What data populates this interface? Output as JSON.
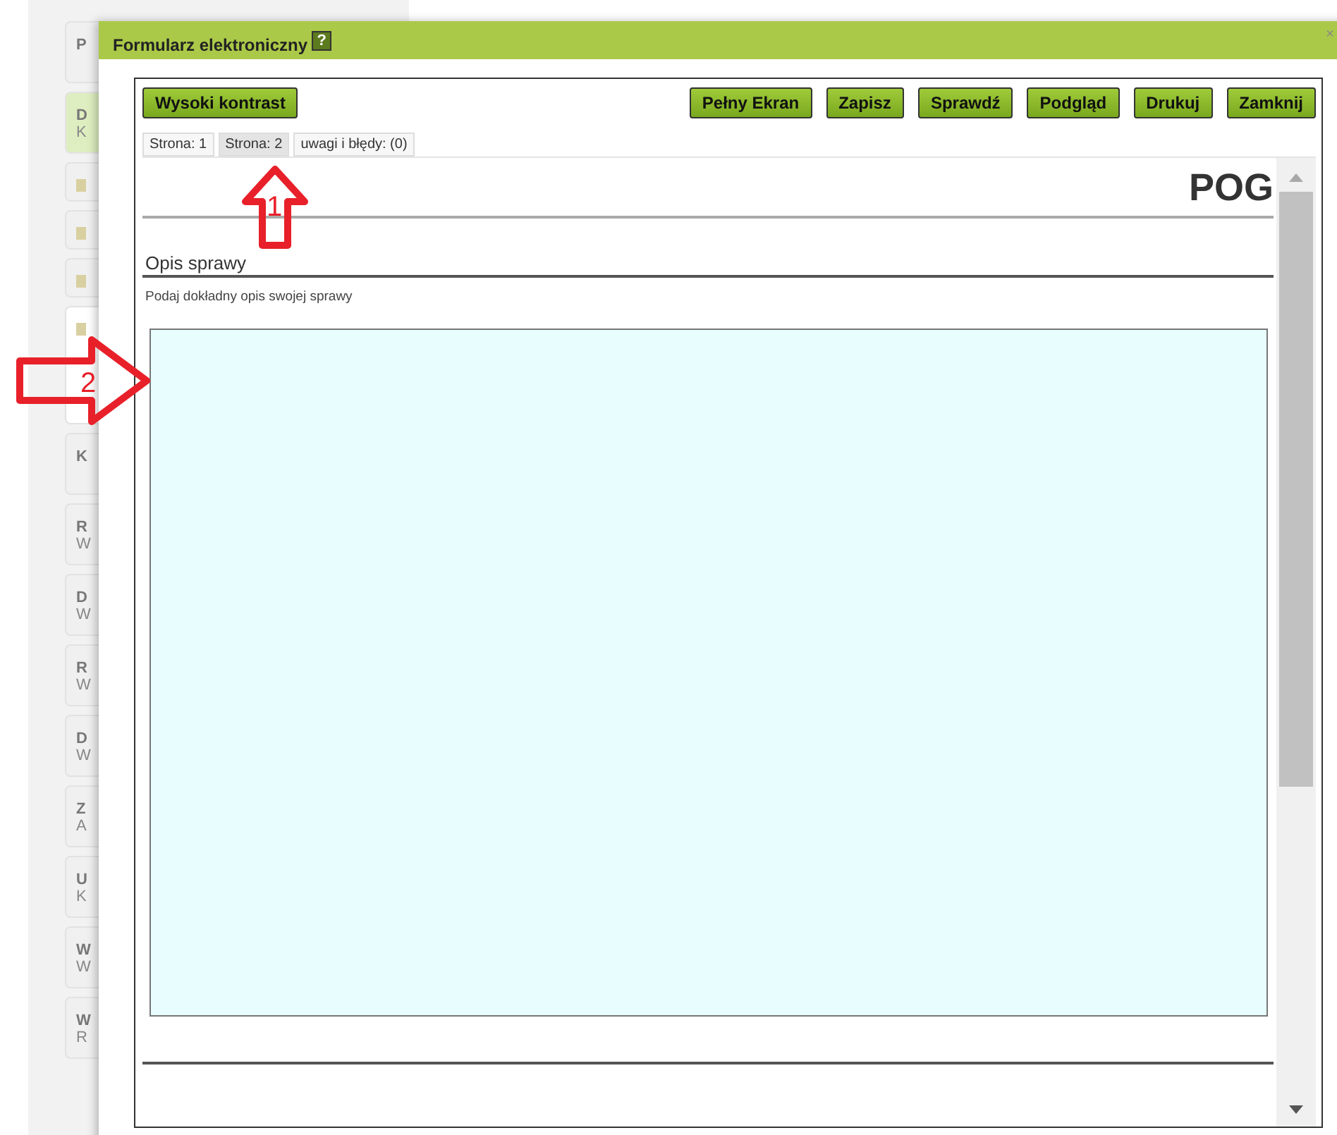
{
  "background_list": [
    {
      "title": "P",
      "kind": "text",
      "selected": false
    },
    {
      "title": "D",
      "subtitle": "K",
      "kind": "text",
      "selected": true
    },
    {
      "kind": "icon",
      "selected": false
    },
    {
      "kind": "icon",
      "selected": false
    },
    {
      "kind": "icon",
      "selected": false
    },
    {
      "kind": "tall",
      "selected": false
    },
    {
      "title": "K",
      "kind": "text",
      "selected": false
    },
    {
      "title": "R",
      "subtitle": "W",
      "kind": "text",
      "selected": false
    },
    {
      "title": "D",
      "subtitle": "W",
      "kind": "text",
      "selected": false
    },
    {
      "title": "R",
      "subtitle": "W",
      "kind": "text",
      "selected": false
    },
    {
      "title": "D",
      "subtitle": "W",
      "kind": "text",
      "selected": false
    },
    {
      "title": "Z",
      "subtitle": "A",
      "kind": "text",
      "selected": false
    },
    {
      "title": "U",
      "subtitle": "K",
      "kind": "text",
      "selected": false
    },
    {
      "title": "W",
      "subtitle": "W",
      "kind": "text",
      "selected": false
    },
    {
      "title": "W",
      "subtitle": "R",
      "kind": "text",
      "selected": false
    }
  ],
  "dialog": {
    "title": "Formularz elektroniczny",
    "help": "?",
    "close": "×",
    "toolbar_left": [
      "Wysoki kontrast"
    ],
    "toolbar_right": [
      "Pełny Ekran",
      "Zapisz",
      "Sprawdź",
      "Podgląd",
      "Drukuj",
      "Zamknij"
    ],
    "tabs": [
      {
        "label": "Strona: 1",
        "selected": false
      },
      {
        "label": "Strona: 2",
        "selected": true
      },
      {
        "label": "uwagi i błędy: (0)",
        "selected": false
      }
    ],
    "form": {
      "heading": "POG",
      "section": "Opis sprawy",
      "hint": "Podaj dokładny opis swojej sprawy"
    }
  },
  "annotations": [
    {
      "label": "1",
      "kind": "up"
    },
    {
      "label": "2",
      "kind": "right"
    }
  ]
}
